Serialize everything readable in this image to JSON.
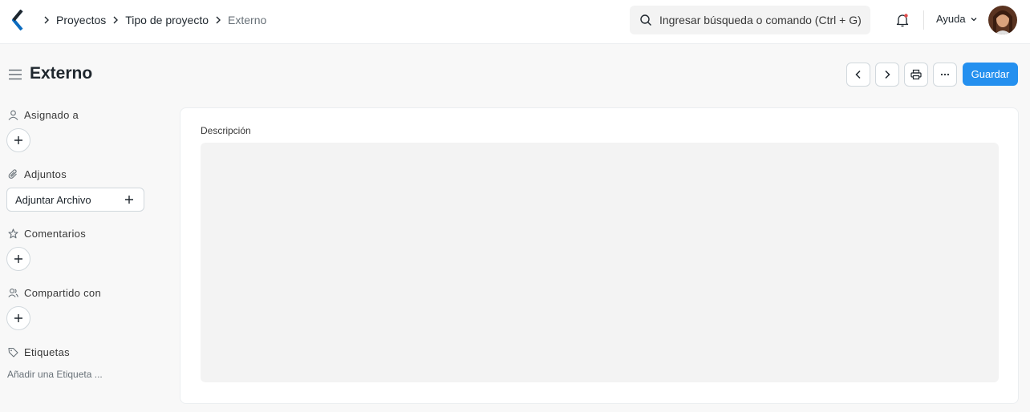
{
  "breadcrumbs": [
    "Proyectos",
    "Tipo de proyecto",
    "Externo"
  ],
  "search": {
    "placeholder": "Ingresar búsqueda o comando (Ctrl + G)"
  },
  "help_label": "Ayuda",
  "page": {
    "title": "Externo",
    "save_label": "Guardar"
  },
  "sidebar": {
    "assigned_label": "Asignado a",
    "attachments_label": "Adjuntos",
    "attach_button_label": "Adjuntar Archivo",
    "comments_label": "Comentarios",
    "shared_label": "Compartido con",
    "tags_label": "Etiquetas",
    "add_tag_label": "Añadir una Etiqueta ..."
  },
  "form": {
    "description_label": "Descripción",
    "description_value": ""
  },
  "colors": {
    "primary": "#2490ef",
    "background": "#f8f8f8",
    "field_background": "#f3f3f3"
  },
  "icons": [
    "logo-icon",
    "chevron-right-icon",
    "search-icon",
    "bell-icon",
    "chevron-down-icon",
    "menu-icon",
    "chevron-left-icon",
    "printer-icon",
    "more-icon",
    "user-icon",
    "paperclip-icon",
    "star-icon",
    "users-icon",
    "tag-icon",
    "plus-icon"
  ]
}
